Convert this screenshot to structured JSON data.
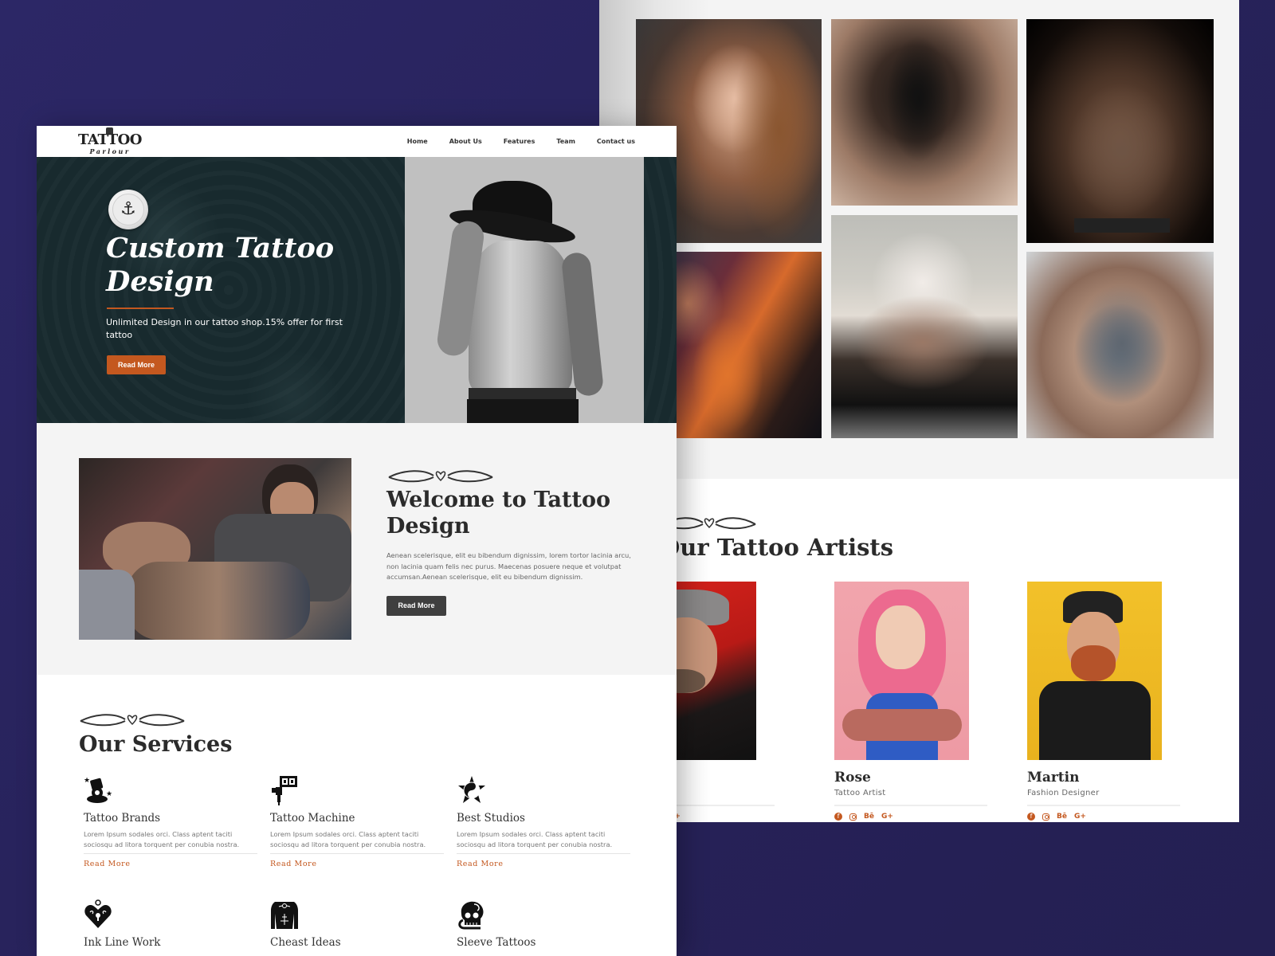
{
  "colors": {
    "accent": "#c4581f",
    "hero_bg": "#182a2e",
    "dark_button": "#3f3f3f",
    "page_bg": "#27225a",
    "section_gray": "#f4f4f4"
  },
  "nav": {
    "logo": {
      "main": "TATTOO",
      "sub": "Parlour"
    },
    "links": [
      {
        "label": "Home"
      },
      {
        "label": "About Us"
      },
      {
        "label": "Features"
      },
      {
        "label": "Team"
      },
      {
        "label": "Contact us"
      }
    ]
  },
  "hero": {
    "badge_icon": "anchor-icon",
    "title": "Custom Tattoo Design",
    "subtitle": "Unlimited Design in our tattoo shop.15% offer for first tattoo",
    "button_label": "Read More"
  },
  "welcome": {
    "title": "Welcome to Tattoo Design",
    "text": "Aenean scelerisque, elit eu bibendum dignissim, lorem tortor lacinia arcu, non lacinia quam felis nec purus. Maecenas posuere neque et volutpat accumsan.Aenean scelerisque, elit eu bibendum dignissim.",
    "button_label": "Read More"
  },
  "services": {
    "title": "Our Services",
    "items": [
      {
        "icon": "tattoo-brands-icon",
        "title": "Tattoo Brands",
        "text": "Lorem Ipsum sodales orci. Class aptent taciti sociosqu ad litora torquent per conubia nostra.",
        "link": "Read More"
      },
      {
        "icon": "tattoo-machine-icon",
        "title": "Tattoo Machine",
        "text": "Lorem Ipsum sodales orci. Class aptent taciti sociosqu ad litora torquent per conubia nostra.",
        "link": "Read More"
      },
      {
        "icon": "yin-yang-star-icon",
        "title": "Best Studios",
        "text": "Lorem Ipsum sodales orci. Class aptent taciti sociosqu ad litora torquent per conubia nostra.",
        "link": "Read More"
      },
      {
        "icon": "heart-lock-icon",
        "title": "Ink Line Work"
      },
      {
        "icon": "tattooed-chest-icon",
        "title": "Cheast Ideas"
      },
      {
        "icon": "skull-snake-icon",
        "title": "Sleeve Tattoos"
      }
    ]
  },
  "gallery": {
    "images": [
      {
        "alt": "woman with tattooed arm"
      },
      {
        "alt": "tattoo machine in gloved hand"
      },
      {
        "alt": "winged back tattoo"
      },
      {
        "alt": "woman with orange back tattoo"
      },
      {
        "alt": "blonde woman with script back tattoo"
      },
      {
        "alt": "tattooed hands on neck"
      }
    ]
  },
  "artists": {
    "title": "Our Tattoo Artists",
    "items": [
      {
        "name": "",
        "role": "",
        "social": [
          "facebook",
          "instagram",
          "behance",
          "google-plus"
        ]
      },
      {
        "name": "Rose",
        "role": "Tattoo Artist",
        "social": [
          "facebook",
          "instagram",
          "behance",
          "google-plus"
        ]
      },
      {
        "name": "Martin",
        "role": "Fashion Designer",
        "social": [
          "facebook",
          "instagram",
          "behance",
          "google-plus"
        ]
      }
    ],
    "social_labels": {
      "facebook": "f",
      "behance": "Bē",
      "google_plus": "G+"
    }
  }
}
